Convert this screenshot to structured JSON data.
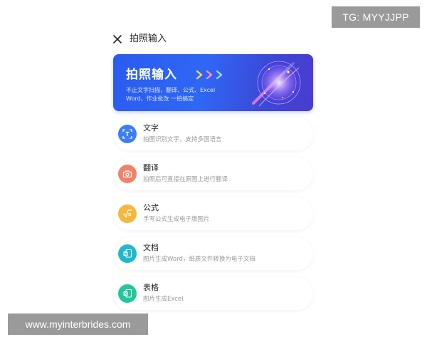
{
  "header": {
    "close_icon": "close-icon",
    "title": "拍照输入"
  },
  "banner": {
    "title": "拍照输入",
    "subtitle_line1": "不止文字扫描，翻译、公式、Excel",
    "subtitle_line2": "Word、作业批改 一拍搞定",
    "colors": {
      "start": "#2a5bf0",
      "end": "#4a3ccf"
    }
  },
  "items": [
    {
      "title": "文字",
      "desc": "拍图识别文字，支持多国语言",
      "icon": "text-scan-icon",
      "color": "#3b7ef6"
    },
    {
      "title": "翻译",
      "desc": "拍照后可直接在原图上进行翻译",
      "icon": "camera-icon",
      "color": "#f0826a"
    },
    {
      "title": "公式",
      "desc": "手写公式生成电子版图片",
      "icon": "formula-icon",
      "color": "#f6b73c"
    },
    {
      "title": "文档",
      "desc": "图片生成Word，纸质文件转换为电子文档",
      "icon": "word-doc-icon",
      "color": "#21b8cf"
    },
    {
      "title": "表格",
      "desc": "图片生成Excel",
      "icon": "excel-sheet-icon",
      "color": "#22c79a"
    }
  ],
  "watermarks": {
    "tg": "TG: MYYJJPP",
    "site": "www.myinterbrides.com"
  }
}
